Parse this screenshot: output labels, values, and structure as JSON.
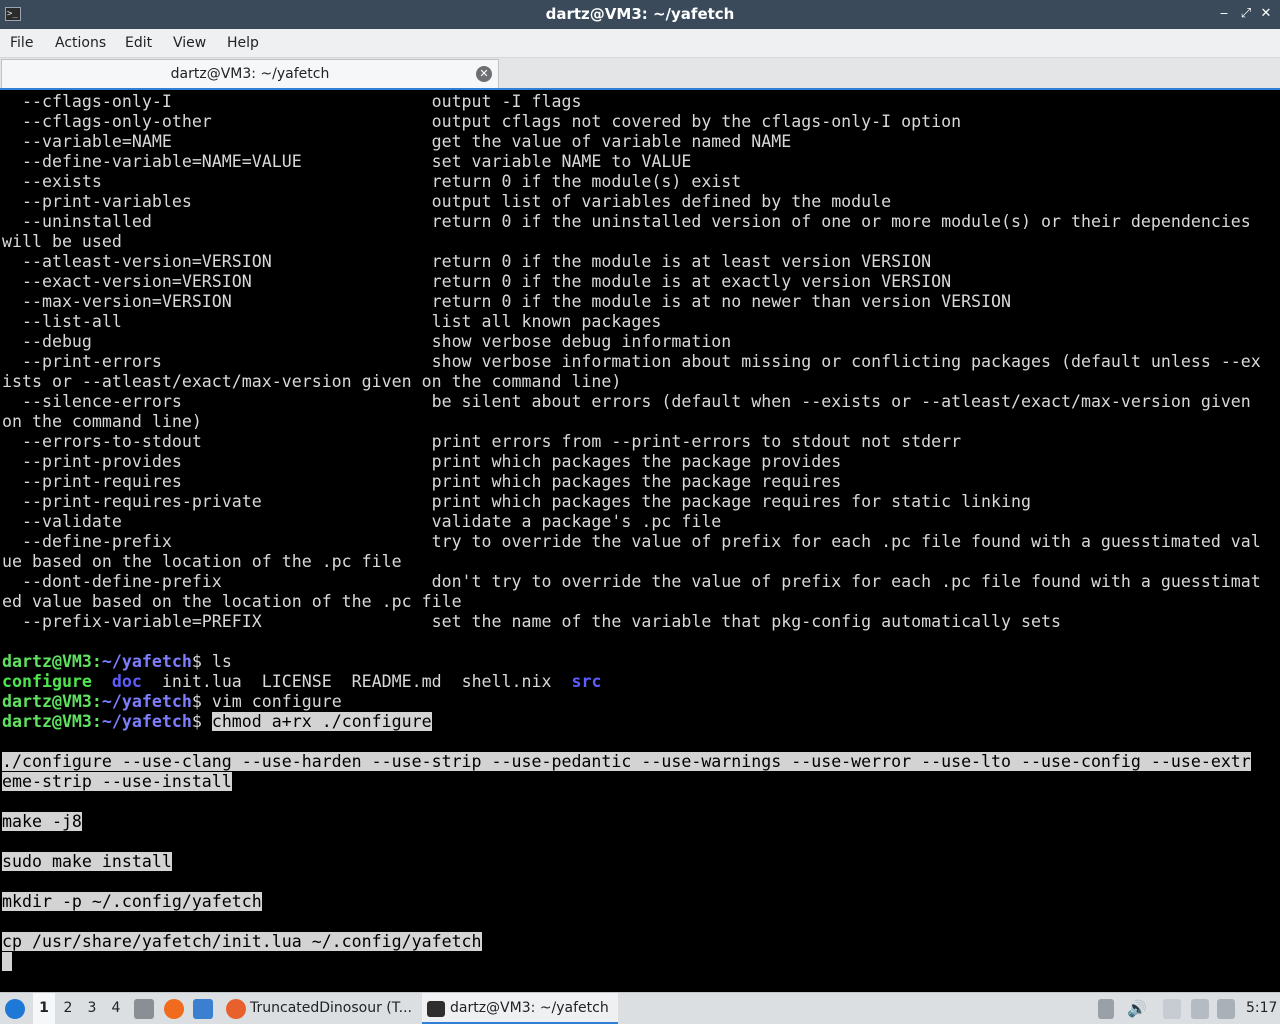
{
  "window": {
    "title": "dartz@VM3: ~/yafetch",
    "minimize": "‒",
    "maximize": "⤢",
    "close": "✕",
    "app_icon": ">_"
  },
  "menu": [
    "File",
    "Actions",
    "Edit",
    "View",
    "Help"
  ],
  "tab": {
    "label": "dartz@VM3: ~/yafetch",
    "close": "✕"
  },
  "terminal": {
    "lines": [
      {
        "segs": [
          {
            "t": "  --cflags-only-I                          output -I flags"
          }
        ]
      },
      {
        "segs": [
          {
            "t": "  --cflags-only-other                      output cflags not covered by the cflags-only-I option"
          }
        ]
      },
      {
        "segs": [
          {
            "t": "  --variable=NAME                          get the value of variable named NAME"
          }
        ]
      },
      {
        "segs": [
          {
            "t": "  --define-variable=NAME=VALUE             set variable NAME to VALUE"
          }
        ]
      },
      {
        "segs": [
          {
            "t": "  --exists                                 return 0 if the module(s) exist"
          }
        ]
      },
      {
        "segs": [
          {
            "t": "  --print-variables                        output list of variables defined by the module"
          }
        ]
      },
      {
        "segs": [
          {
            "t": "  --uninstalled                            return 0 if the uninstalled version of one or more module(s) or their dependencies"
          }
        ]
      },
      {
        "segs": [
          {
            "t": "will be used"
          }
        ]
      },
      {
        "segs": [
          {
            "t": "  --atleast-version=VERSION                return 0 if the module is at least version VERSION"
          }
        ]
      },
      {
        "segs": [
          {
            "t": "  --exact-version=VERSION                  return 0 if the module is at exactly version VERSION"
          }
        ]
      },
      {
        "segs": [
          {
            "t": "  --max-version=VERSION                    return 0 if the module is at no newer than version VERSION"
          }
        ]
      },
      {
        "segs": [
          {
            "t": "  --list-all                               list all known packages"
          }
        ]
      },
      {
        "segs": [
          {
            "t": "  --debug                                  show verbose debug information"
          }
        ]
      },
      {
        "segs": [
          {
            "t": "  --print-errors                           show verbose information about missing or conflicting packages (default unless --ex"
          }
        ]
      },
      {
        "segs": [
          {
            "t": "ists or --atleast/exact/max-version given on the command line)"
          }
        ]
      },
      {
        "segs": [
          {
            "t": "  --silence-errors                         be silent about errors (default when --exists or --atleast/exact/max-version given"
          }
        ]
      },
      {
        "segs": [
          {
            "t": "on the command line)"
          }
        ]
      },
      {
        "segs": [
          {
            "t": "  --errors-to-stdout                       print errors from --print-errors to stdout not stderr"
          }
        ]
      },
      {
        "segs": [
          {
            "t": "  --print-provides                         print which packages the package provides"
          }
        ]
      },
      {
        "segs": [
          {
            "t": "  --print-requires                         print which packages the package requires"
          }
        ]
      },
      {
        "segs": [
          {
            "t": "  --print-requires-private                 print which packages the package requires for static linking"
          }
        ]
      },
      {
        "segs": [
          {
            "t": "  --validate                               validate a package's .pc file"
          }
        ]
      },
      {
        "segs": [
          {
            "t": "  --define-prefix                          try to override the value of prefix for each .pc file found with a guesstimated val"
          }
        ]
      },
      {
        "segs": [
          {
            "t": "ue based on the location of the .pc file"
          }
        ]
      },
      {
        "segs": [
          {
            "t": "  --dont-define-prefix                     don't try to override the value of prefix for each .pc file found with a guesstimat"
          }
        ]
      },
      {
        "segs": [
          {
            "t": "ed value based on the location of the .pc file"
          }
        ]
      },
      {
        "segs": [
          {
            "t": "  --prefix-variable=PREFIX                 set the name of the variable that pkg-config automatically sets"
          }
        ]
      },
      {
        "segs": [
          {
            "t": ""
          }
        ]
      },
      {
        "segs": [
          {
            "t": "dartz@VM3",
            "c": "pr-user"
          },
          {
            "t": ":",
            "c": "pr-user"
          },
          {
            "t": "~/yafetch",
            "c": "pr-path"
          },
          {
            "t": "$ ls"
          }
        ]
      },
      {
        "segs": [
          {
            "t": "configure",
            "c": "exe"
          },
          {
            "t": "  "
          },
          {
            "t": "doc",
            "c": "dir"
          },
          {
            "t": "  init.lua  LICENSE  README.md  shell.nix  "
          },
          {
            "t": "src",
            "c": "dir"
          }
        ]
      },
      {
        "segs": [
          {
            "t": "dartz@VM3",
            "c": "pr-user"
          },
          {
            "t": ":",
            "c": "pr-user"
          },
          {
            "t": "~/yafetch",
            "c": "pr-path"
          },
          {
            "t": "$ vim configure"
          }
        ]
      },
      {
        "segs": [
          {
            "t": "dartz@VM3",
            "c": "pr-user"
          },
          {
            "t": ":",
            "c": "pr-user"
          },
          {
            "t": "~/yafetch",
            "c": "pr-path"
          },
          {
            "t": "$ "
          },
          {
            "t": "chmod a+rx ./configure",
            "c": "hl"
          }
        ]
      },
      {
        "segs": [
          {
            "t": ""
          }
        ]
      },
      {
        "segs": [
          {
            "t": "./configure --use-clang --use-harden --use-strip --use-pedantic --use-warnings --use-werror --use-lto --use-config --use-extr",
            "c": "hl"
          }
        ]
      },
      {
        "segs": [
          {
            "t": "eme-strip --use-install",
            "c": "hl"
          }
        ]
      },
      {
        "segs": [
          {
            "t": ""
          }
        ]
      },
      {
        "segs": [
          {
            "t": "make -j8",
            "c": "hl"
          }
        ]
      },
      {
        "segs": [
          {
            "t": ""
          }
        ]
      },
      {
        "segs": [
          {
            "t": "sudo make install",
            "c": "hl"
          }
        ]
      },
      {
        "segs": [
          {
            "t": ""
          }
        ]
      },
      {
        "segs": [
          {
            "t": "mkdir -p ~/.config/yafetch",
            "c": "hl"
          }
        ]
      },
      {
        "segs": [
          {
            "t": ""
          }
        ]
      },
      {
        "segs": [
          {
            "t": "cp /usr/share/yafetch/init.lua ~/.config/yafetch",
            "c": "hl"
          }
        ]
      },
      {
        "segs": [
          {
            "t": " ",
            "c": "hl"
          }
        ]
      }
    ]
  },
  "taskbar": {
    "workspaces": [
      "1",
      "2",
      "3",
      "4"
    ],
    "tasks": [
      {
        "label": "TruncatedDinosour (T...",
        "icon": "firefox-icon"
      },
      {
        "label": "dartz@VM3: ~/yafetch",
        "icon": "terminal-icon"
      }
    ],
    "clock": "5:17",
    "colors": {
      "accent": "#2f7fd4"
    }
  }
}
